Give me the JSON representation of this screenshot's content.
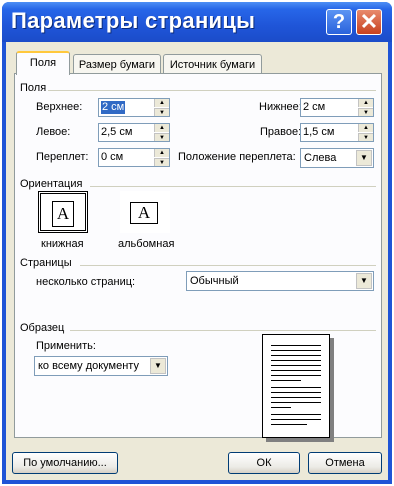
{
  "window": {
    "title": "Параметры страницы",
    "help_glyph": "?",
    "close_glyph": "✕"
  },
  "tabs": [
    {
      "label": "Поля",
      "active": true
    },
    {
      "label": "Размер бумаги",
      "active": false
    },
    {
      "label": "Источник бумаги",
      "active": false
    }
  ],
  "margins": {
    "group_label": "Поля",
    "top": {
      "label": "Верхнее:",
      "value": "2 см"
    },
    "bottom": {
      "label": "Нижнее:",
      "value": "2 см"
    },
    "left": {
      "label": "Левое:",
      "value": "2,5 см"
    },
    "right": {
      "label": "Правое:",
      "value": "1,5 см"
    },
    "gutter": {
      "label": "Переплет:",
      "value": "0 см"
    },
    "gutter_position": {
      "label": "Положение переплета:",
      "value": "Слева"
    }
  },
  "orientation": {
    "group_label": "Ориентация",
    "icon_letter": "A",
    "portrait_label": "книжная",
    "landscape_label": "альбомная",
    "selected": "portrait"
  },
  "pages": {
    "group_label": "Страницы",
    "multiple_label": "несколько страниц:",
    "multiple_value": "Обычный"
  },
  "preview": {
    "group_label": "Образец",
    "apply_label": "Применить:",
    "apply_value": "ко всему документу"
  },
  "buttons": {
    "default": "По умолчанию...",
    "ok": "ОК",
    "cancel": "Отмена"
  },
  "glyphs": {
    "spin_up": "▲",
    "spin_down": "▼",
    "combo_arrow": "▼"
  }
}
